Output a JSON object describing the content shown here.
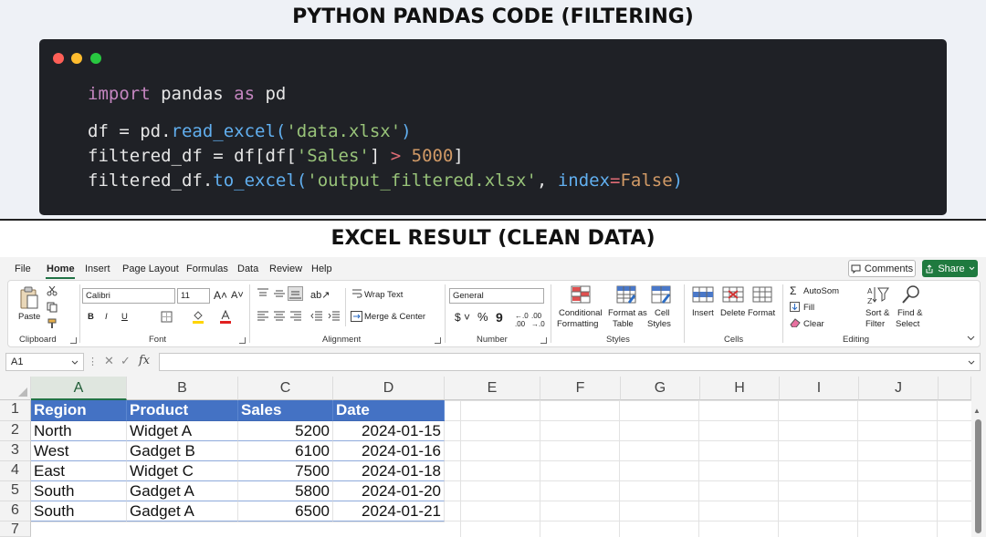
{
  "titles": {
    "top": "PYTHON PANDAS CODE (FILTERING)",
    "bottom": "EXCEL RESULT (CLEAN DATA)"
  },
  "code": {
    "line1": {
      "kw_import": "import",
      "module": " pandas ",
      "kw_as": "as",
      "alias": " pd"
    },
    "line2": {
      "lhs": "df = pd.",
      "fn": "read_excel",
      "open": "(",
      "arg": "'data.xlsx'",
      "close": ")"
    },
    "line3": {
      "lhs": "filtered_df = df[df[",
      "key": "'Sales'",
      "mid": "] ",
      "op": ">",
      "sp": " ",
      "num": "5000",
      "end": "]"
    },
    "line4": {
      "lhs": "filtered_df.",
      "fn": "to_excel",
      "open": "(",
      "arg": "'output_filtered.xlsx'",
      "comma": ", ",
      "kwarg": "index",
      "eq": "=",
      "val": "False",
      "close": ")"
    }
  },
  "excel": {
    "menu": [
      "File",
      "Home",
      "Insert",
      "Page Layout",
      "Formulas",
      "Data",
      "Review",
      "Help"
    ],
    "comments": "Comments",
    "share": "Share",
    "ribbon": {
      "clipboard": {
        "paste": "Paste",
        "label": "Clipboard"
      },
      "font": {
        "name": "Calibri",
        "size": "11",
        "label": "Font",
        "bold": "B",
        "italic": "I",
        "underline": "U"
      },
      "alignment": {
        "wrap": "Wrap Text",
        "merge": "Merge & Center",
        "label": "Alignment"
      },
      "number": {
        "format": "General",
        "label": "Number"
      },
      "styles": {
        "conditional": "Conditional",
        "formatting": "Formatting",
        "format_as": "Format as",
        "table": "Table",
        "cell": "Cell",
        "cell_styles": "Styles",
        "label": "Styles"
      },
      "cells": {
        "insert": "Insert",
        "delete": "Delete",
        "format": "Format",
        "label": "Cells"
      },
      "editing": {
        "autosum": "AutoSom",
        "fill": "Fill",
        "clear": "Clear",
        "sort": "Sort &",
        "filter": "Filter",
        "find": "Find &",
        "select": "Select",
        "label": "Editing"
      }
    },
    "name_box": "A1",
    "fx": "fx",
    "columns": [
      "A",
      "B",
      "C",
      "D",
      "E",
      "F",
      "G",
      "H",
      "I",
      "J"
    ],
    "rows": [
      "1",
      "2",
      "3",
      "4",
      "5",
      "6",
      "7"
    ],
    "header": [
      "Region",
      "Product",
      "Sales",
      "Date"
    ],
    "data": [
      [
        "North",
        "Widget A",
        "5200",
        "2024-01-15"
      ],
      [
        "West",
        "Gadget B",
        "6100",
        "2024-01-16"
      ],
      [
        "East",
        "Widget C",
        "7500",
        "2024-01-18"
      ],
      [
        "South",
        "Gadget A",
        "5800",
        "2024-01-20"
      ],
      [
        "South",
        "Gadget A",
        "6500",
        "2024-01-21"
      ]
    ]
  }
}
